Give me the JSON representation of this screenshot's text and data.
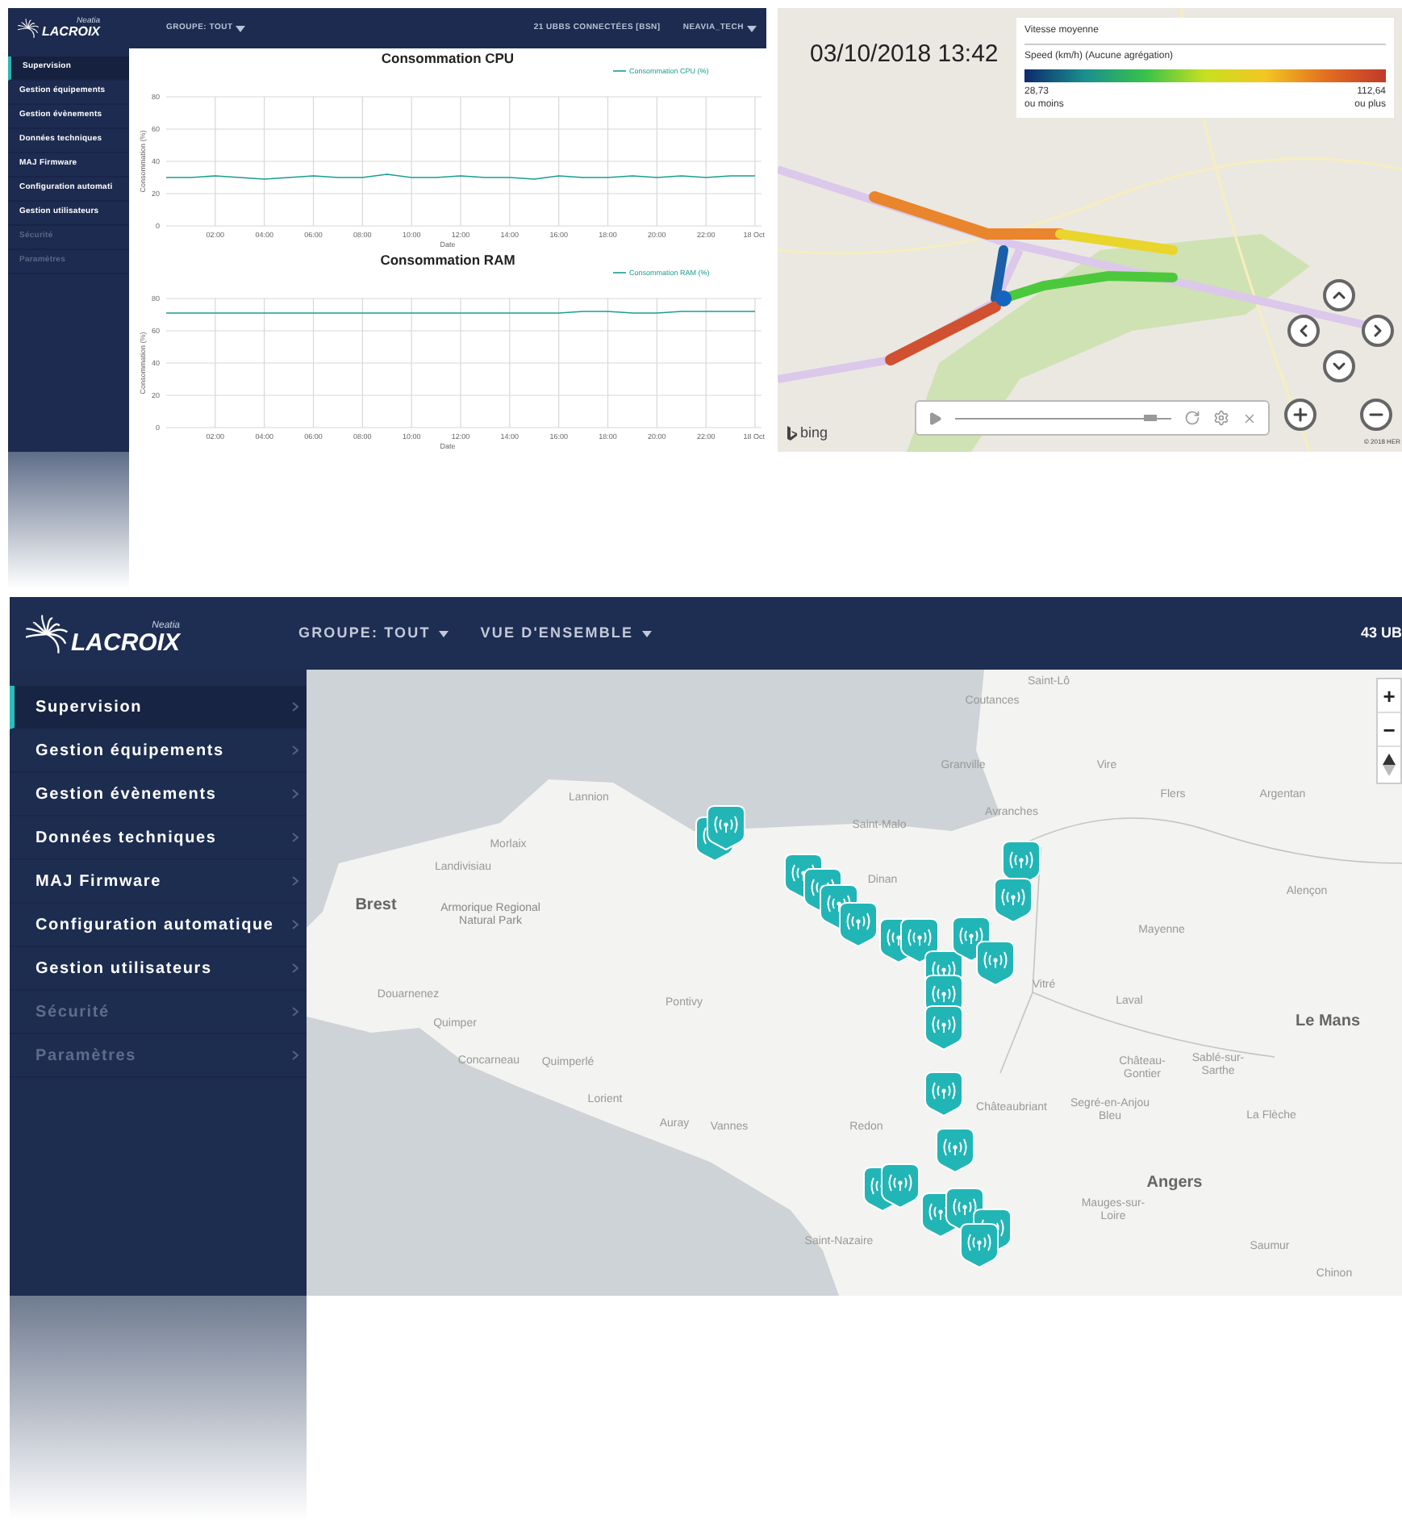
{
  "dashboard_window": {
    "logo": {
      "subtitle": "Neatia",
      "name": "LACROIX"
    },
    "header_menus": [
      "GROUPE: TOUT"
    ],
    "header_right": [
      {
        "label": "21 UBBS CONNECTÉES [BSN]",
        "dropdown": false
      },
      {
        "label": "NEAVIA_TECH",
        "dropdown": true
      }
    ],
    "sidebar": {
      "items": [
        {
          "label": "Supervision",
          "selected": true,
          "disabled": false
        },
        {
          "label": "Gestion équipements",
          "selected": false,
          "disabled": false
        },
        {
          "label": "Gestion évènements",
          "selected": false,
          "disabled": false
        },
        {
          "label": "Données techniques",
          "selected": false,
          "disabled": false
        },
        {
          "label": "MAJ Firmware",
          "selected": false,
          "disabled": false
        },
        {
          "label": "Configuration automati",
          "selected": false,
          "disabled": false
        },
        {
          "label": "Gestion utilisateurs",
          "selected": false,
          "disabled": false
        },
        {
          "label": "Sécurité",
          "selected": false,
          "disabled": true
        },
        {
          "label": "Paramètres",
          "selected": false,
          "disabled": true
        }
      ]
    },
    "charts": [
      {
        "chart_data": {
          "type": "line",
          "title": "Consommation CPU",
          "xlabel": "Date",
          "ylabel": "Consommation (%)",
          "grid": true,
          "x": [
            0,
            1,
            2,
            3,
            4,
            5,
            6,
            7,
            8,
            9,
            10,
            11,
            12,
            13,
            14,
            15,
            16,
            17,
            18,
            19,
            20,
            21,
            22,
            23,
            24
          ],
          "xlim": [
            0,
            24
          ],
          "ylim": [
            0,
            80
          ],
          "yticks": [
            0,
            20,
            40,
            60,
            80
          ],
          "xticks": [
            {
              "value": 2,
              "label": "02:00"
            },
            {
              "value": 4,
              "label": "04:00"
            },
            {
              "value": 6,
              "label": "06:00"
            },
            {
              "value": 8,
              "label": "08:00"
            },
            {
              "value": 10,
              "label": "10:00"
            },
            {
              "value": 12,
              "label": "12:00"
            },
            {
              "value": 14,
              "label": "14:00"
            },
            {
              "value": 16,
              "label": "16:00"
            },
            {
              "value": 18,
              "label": "18:00"
            },
            {
              "value": 20,
              "label": "20:00"
            },
            {
              "value": 22,
              "label": "22:00"
            },
            {
              "value": 24,
              "label": "18 Oct"
            }
          ],
          "series": [
            {
              "name": "Consommation CPU (%)",
              "color": "#1a9e8f",
              "values": [
                30,
                30,
                31,
                30,
                29,
                30,
                31,
                30,
                30,
                32,
                30,
                30,
                31,
                30,
                30,
                29,
                31,
                30,
                30,
                31,
                30,
                31,
                30,
                31,
                31
              ]
            }
          ]
        }
      },
      {
        "chart_data": {
          "type": "line",
          "title": "Consommation RAM",
          "xlabel": "Date",
          "ylabel": "Consommation (%)",
          "grid": true,
          "x": [
            0,
            1,
            2,
            3,
            4,
            5,
            6,
            7,
            8,
            9,
            10,
            11,
            12,
            13,
            14,
            15,
            16,
            17,
            18,
            19,
            20,
            21,
            22,
            23,
            24
          ],
          "xlim": [
            0,
            24
          ],
          "ylim": [
            0,
            80
          ],
          "yticks": [
            0,
            20,
            40,
            60,
            80
          ],
          "xticks": [
            {
              "value": 2,
              "label": "02:00"
            },
            {
              "value": 4,
              "label": "04:00"
            },
            {
              "value": 6,
              "label": "06:00"
            },
            {
              "value": 8,
              "label": "08:00"
            },
            {
              "value": 10,
              "label": "10:00"
            },
            {
              "value": 12,
              "label": "12:00"
            },
            {
              "value": 14,
              "label": "14:00"
            },
            {
              "value": 16,
              "label": "16:00"
            },
            {
              "value": 18,
              "label": "18:00"
            },
            {
              "value": 20,
              "label": "20:00"
            },
            {
              "value": 22,
              "label": "22:00"
            },
            {
              "value": 24,
              "label": "18 Oct"
            }
          ],
          "series": [
            {
              "name": "Consommation RAM (%)",
              "color": "#1a9e8f",
              "values": [
                71,
                71,
                71,
                71,
                71,
                71,
                71,
                71,
                71,
                71,
                71,
                71,
                71,
                71,
                71,
                71,
                71,
                72,
                72,
                71,
                71,
                72,
                72,
                72,
                72
              ]
            }
          ]
        }
      }
    ]
  },
  "speed_map_window": {
    "timestamp": "03/10/2018 13:42",
    "legend": {
      "title": "Vitesse moyenne",
      "subtitle": "Speed (km/h) (Aucune agrégation)",
      "min_value": "28,73",
      "min_caption": "ou moins",
      "max_value": "112,64",
      "max_caption": "ou plus"
    },
    "player": {
      "level": 0.9
    },
    "attribution": "bing",
    "copyright": "© 2018 HER"
  },
  "overview_window": {
    "logo": {
      "subtitle": "Neatia",
      "name": "LACROIX"
    },
    "header_menus": [
      "GROUPE: TOUT",
      "VUE D'ENSEMBLE"
    ],
    "connected_count": "43 UB",
    "sidebar": {
      "items": [
        {
          "label": "Supervision",
          "selected": true,
          "disabled": false
        },
        {
          "label": "Gestion équipements",
          "selected": false,
          "disabled": false
        },
        {
          "label": "Gestion évènements",
          "selected": false,
          "disabled": false
        },
        {
          "label": "Données techniques",
          "selected": false,
          "disabled": false
        },
        {
          "label": "MAJ Firmware",
          "selected": false,
          "disabled": false
        },
        {
          "label": "Configuration automatique",
          "selected": false,
          "disabled": false
        },
        {
          "label": "Gestion utilisateurs",
          "selected": false,
          "disabled": false
        },
        {
          "label": "Sécurité",
          "selected": false,
          "disabled": true
        },
        {
          "label": "Paramètres",
          "selected": false,
          "disabled": true
        }
      ]
    },
    "map": {
      "zoom_controls": [
        "+",
        "−"
      ],
      "places": [
        {
          "name": "Saint-Lô",
          "kind": "town"
        },
        {
          "name": "Coutances",
          "kind": "town"
        },
        {
          "name": "Granville",
          "kind": "town"
        },
        {
          "name": "Vire",
          "kind": "town"
        },
        {
          "name": "Flers",
          "kind": "town"
        },
        {
          "name": "Argentan",
          "kind": "town"
        },
        {
          "name": "Avranches",
          "kind": "town"
        },
        {
          "name": "Saint-Malo",
          "kind": "town"
        },
        {
          "name": "Lannion",
          "kind": "town"
        },
        {
          "name": "Morlaix",
          "kind": "town"
        },
        {
          "name": "Landivisiau",
          "kind": "town"
        },
        {
          "name": "Dinan",
          "kind": "town"
        },
        {
          "name": "Alençon",
          "kind": "town"
        },
        {
          "name": "Brest",
          "kind": "city"
        },
        {
          "name": "Armorique Regional Natural Park",
          "kind": "park"
        },
        {
          "name": "Mayenne",
          "kind": "town"
        },
        {
          "name": "Vitré",
          "kind": "town"
        },
        {
          "name": "Douarnenez",
          "kind": "town"
        },
        {
          "name": "Laval",
          "kind": "town"
        },
        {
          "name": "Pontivy",
          "kind": "town"
        },
        {
          "name": "Le Mans",
          "kind": "city"
        },
        {
          "name": "Quimper",
          "kind": "town"
        },
        {
          "name": "Concarneau",
          "kind": "town"
        },
        {
          "name": "Quimperlé",
          "kind": "town"
        },
        {
          "name": "Château-Gontier",
          "kind": "town"
        },
        {
          "name": "Sablé-sur-Sarthe",
          "kind": "town"
        },
        {
          "name": "Lorient",
          "kind": "town"
        },
        {
          "name": "Châteaubriant",
          "kind": "town"
        },
        {
          "name": "Segré-en-Anjou Bleu",
          "kind": "town"
        },
        {
          "name": "La Flèche",
          "kind": "town"
        },
        {
          "name": "Auray",
          "kind": "town"
        },
        {
          "name": "Vannes",
          "kind": "town"
        },
        {
          "name": "Redon",
          "kind": "town"
        },
        {
          "name": "Angers",
          "kind": "city"
        },
        {
          "name": "Mauges-sur-Loire",
          "kind": "town"
        },
        {
          "name": "Saint-Nazaire",
          "kind": "town"
        },
        {
          "name": "Saumur",
          "kind": "town"
        },
        {
          "name": "Chinon",
          "kind": "town"
        }
      ]
    }
  }
}
